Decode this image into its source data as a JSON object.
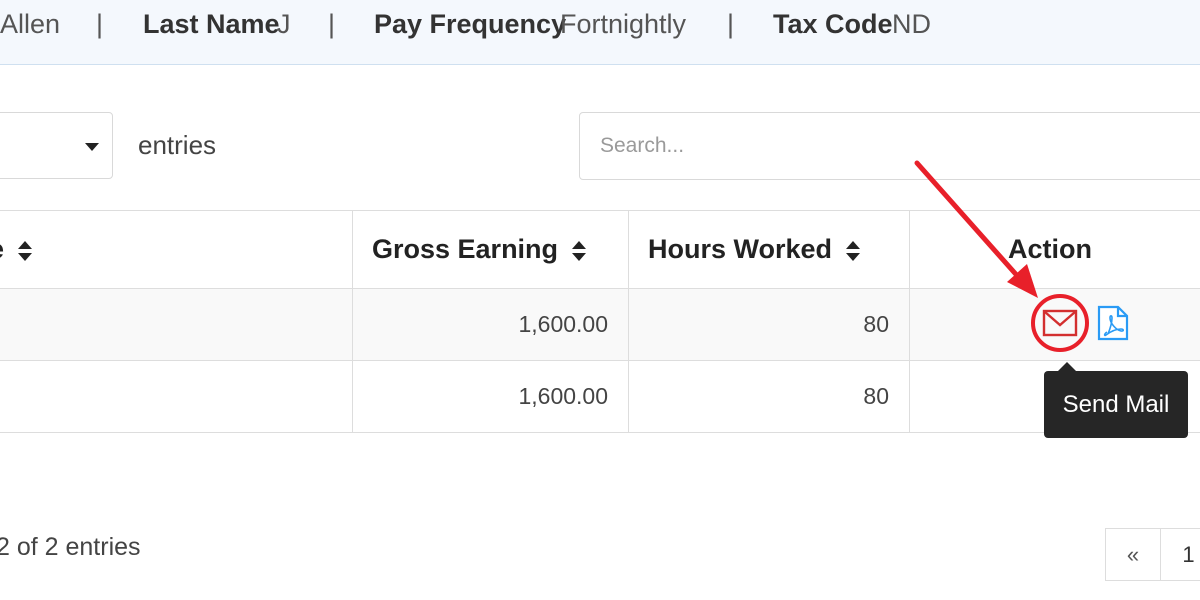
{
  "employee_info": {
    "first_name_value": "Allen",
    "separator": "|",
    "last_name_label": "Last Name",
    "last_name_value": "J",
    "pay_frequency_label": "Pay Frequency",
    "pay_frequency_value": "Fortnightly",
    "tax_code_label": "Tax Code",
    "tax_code_value": "ND"
  },
  "controls": {
    "entries_label": "entries",
    "search_placeholder": "Search..."
  },
  "table": {
    "headers": {
      "first_col_fragment": "e",
      "gross_earning": "Gross Earning",
      "hours_worked": "Hours Worked",
      "action": "Action"
    },
    "rows": [
      {
        "gross_earning": "1,600.00",
        "hours_worked": "80"
      },
      {
        "gross_earning": "1,600.00",
        "hours_worked": "80"
      }
    ]
  },
  "tooltip": {
    "text": "Send Mail"
  },
  "icons": {
    "mail": "mail-icon",
    "pdf": "pdf-icon",
    "sort": "sort-icon"
  },
  "colors": {
    "highlight_red": "#e8202a",
    "mail_icon": "#d32f2f",
    "pdf_icon": "#2a9bf5",
    "tooltip_bg": "#262626"
  },
  "footer": {
    "info_text": "2 of 2 entries",
    "pagination": {
      "prev": "«",
      "page_1": "1"
    }
  }
}
